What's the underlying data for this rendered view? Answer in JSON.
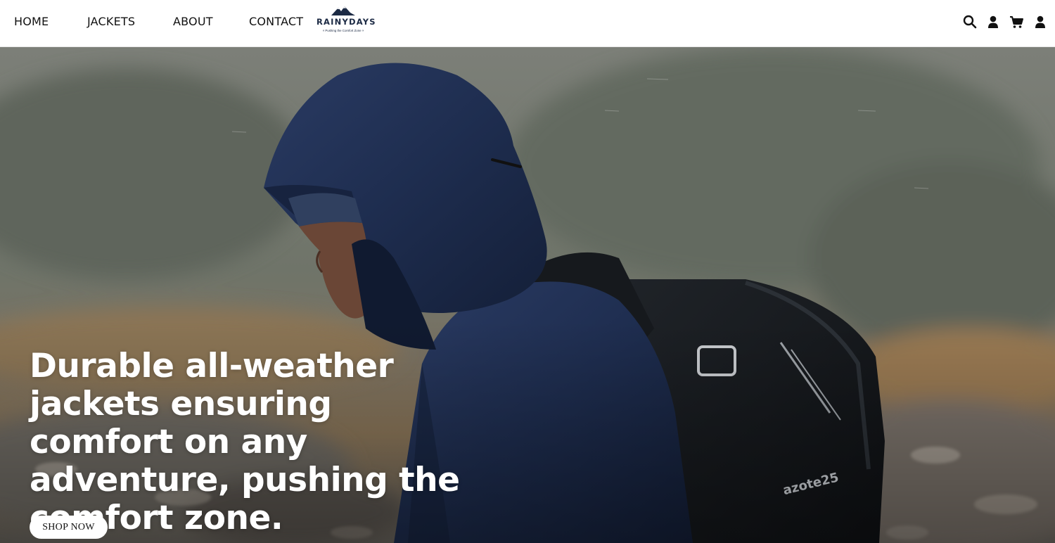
{
  "nav": {
    "items": [
      {
        "label": "HOME"
      },
      {
        "label": "JACKETS"
      },
      {
        "label": "ABOUT"
      },
      {
        "label": "CONTACT"
      }
    ]
  },
  "logo": {
    "wordmark": "RAINYDAYS",
    "tagline": "× Pushing the Comfort Zone ×"
  },
  "header_icons": [
    "search-icon",
    "user-icon",
    "cart-icon",
    "account-icon"
  ],
  "hero": {
    "headline": "Durable all-weather jackets ensuring comfort on any adventure, pushing the comfort zone.",
    "cta_label": "SHOP NOW",
    "backpack_brand": "azote25"
  },
  "colors": {
    "brand_navy": "#1c2a44",
    "jacket_navy": "#1e2d4f",
    "cta_background": "#ffffff"
  }
}
